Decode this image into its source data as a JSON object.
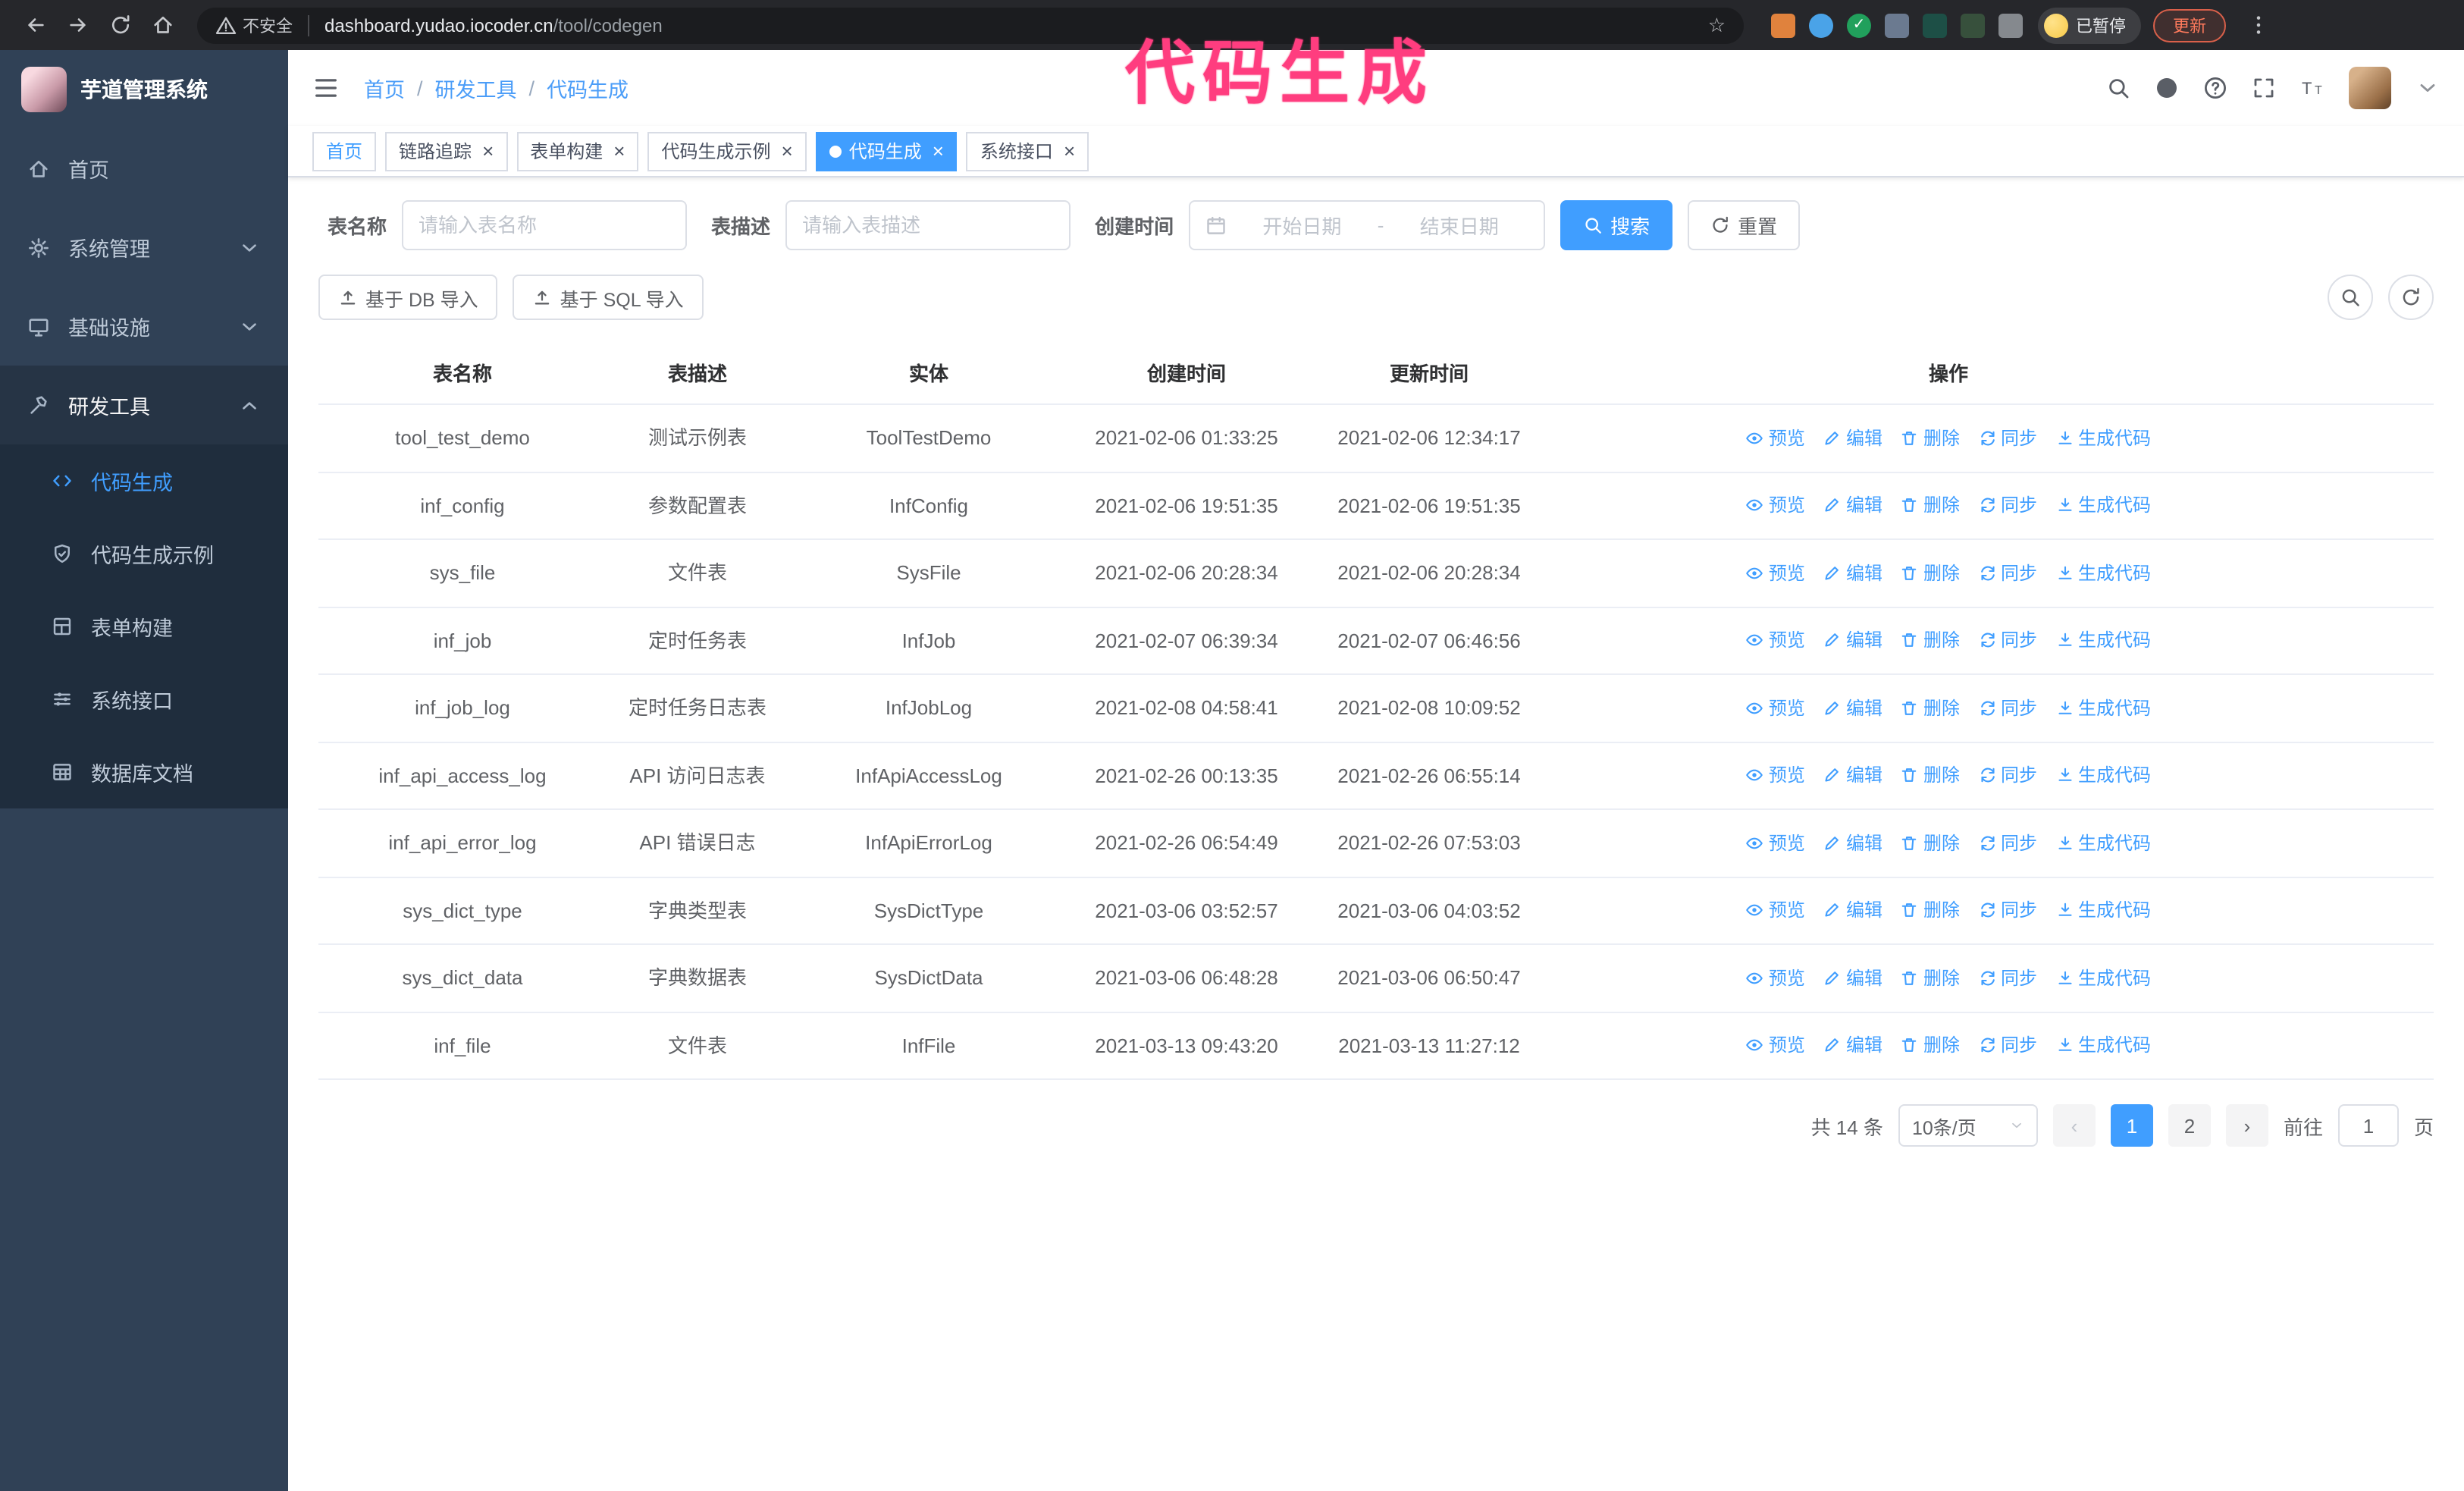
{
  "theme": {
    "primary": "#409eff",
    "sidebar_bg": "#304156",
    "submenu_bg": "#1f2d3d"
  },
  "browser": {
    "security_label": "不安全",
    "url_host": "dashboard.yudao.iocoder.cn",
    "url_path": "/tool/codegen",
    "paused_badge": "已暂停",
    "update_button": "更新",
    "extensions": [
      {
        "name": "ext-fox-icon",
        "color": "#e0823d",
        "shape": "square"
      },
      {
        "name": "ext-drop-icon",
        "color": "#4aa3e8",
        "shape": "circle"
      },
      {
        "name": "ext-check-icon",
        "color": "#21a05c",
        "shape": "circle",
        "glyph": "✓"
      },
      {
        "name": "ext-people-icon",
        "color": "#6b7a90",
        "shape": "square"
      },
      {
        "name": "ext-wallet-icon",
        "color": "#1d4f46",
        "shape": "square"
      },
      {
        "name": "ext-leaf-icon",
        "color": "#37503c",
        "shape": "square"
      },
      {
        "name": "ext-puzzle-icon",
        "color": "#85898e",
        "shape": "square"
      }
    ]
  },
  "annotation": {
    "text": "代码生成",
    "color": "#ff3d7f"
  },
  "sidebar": {
    "logo_title": "芋道管理系统",
    "menu": [
      {
        "key": "home",
        "label": "首页",
        "icon": "home-icon"
      },
      {
        "key": "system",
        "label": "系统管理",
        "icon": "gear-icon",
        "chevron": "down"
      },
      {
        "key": "infra",
        "label": "基础设施",
        "icon": "infra-icon",
        "chevron": "down"
      },
      {
        "key": "devtools",
        "label": "研发工具",
        "icon": "tools-icon",
        "chevron": "up",
        "expanded": true
      }
    ],
    "submenu": [
      {
        "key": "codegen",
        "label": "代码生成",
        "icon": "code-icon",
        "active": true
      },
      {
        "key": "codegen-demo",
        "label": "代码生成示例",
        "icon": "example-icon"
      },
      {
        "key": "form-builder",
        "label": "表单构建",
        "icon": "form-icon"
      },
      {
        "key": "system-api",
        "label": "系统接口",
        "icon": "api-icon"
      },
      {
        "key": "db-doc",
        "label": "数据库文档",
        "icon": "dbdoc-icon"
      }
    ]
  },
  "header": {
    "breadcrumb": [
      {
        "label": "首页"
      },
      {
        "label": "研发工具"
      },
      {
        "label": "代码生成"
      }
    ],
    "separator": "/"
  },
  "tags": [
    {
      "key": "home",
      "label": "首页",
      "closable": false,
      "home": true
    },
    {
      "key": "tracer",
      "label": "链路追踪",
      "closable": true
    },
    {
      "key": "form-builder",
      "label": "表单构建",
      "closable": true
    },
    {
      "key": "codegen-demo",
      "label": "代码生成示例",
      "closable": true
    },
    {
      "key": "codegen",
      "label": "代码生成",
      "closable": true,
      "active": true
    },
    {
      "key": "system-api",
      "label": "系统接口",
      "closable": true
    }
  ],
  "filters": {
    "table_name_label": "表名称",
    "table_name_placeholder": "请输入表名称",
    "table_desc_label": "表描述",
    "table_desc_placeholder": "请输入表描述",
    "create_time_label": "创建时间",
    "date_start_placeholder": "开始日期",
    "date_separator": "-",
    "date_end_placeholder": "结束日期",
    "search_button": "搜索",
    "reset_button": "重置"
  },
  "toolbar": {
    "import_db": "基于 DB 导入",
    "import_sql": "基于 SQL 导入"
  },
  "table": {
    "columns": [
      "表名称",
      "表描述",
      "实体",
      "创建时间",
      "更新时间",
      "操作"
    ],
    "row_actions": [
      "预览",
      "编辑",
      "删除",
      "同步",
      "生成代码"
    ],
    "rows": [
      [
        "tool_test_demo",
        "测试示例表",
        "ToolTestDemo",
        "2021-02-06 01:33:25",
        "2021-02-06 12:34:17"
      ],
      [
        "inf_config",
        "参数配置表",
        "InfConfig",
        "2021-02-06 19:51:35",
        "2021-02-06 19:51:35"
      ],
      [
        "sys_file",
        "文件表",
        "SysFile",
        "2021-02-06 20:28:34",
        "2021-02-06 20:28:34"
      ],
      [
        "inf_job",
        "定时任务表",
        "InfJob",
        "2021-02-07 06:39:34",
        "2021-02-07 06:46:56"
      ],
      [
        "inf_job_log",
        "定时任务日志表",
        "InfJobLog",
        "2021-02-08 04:58:41",
        "2021-02-08 10:09:52"
      ],
      [
        "inf_api_access_log",
        "API 访问日志表",
        "InfApiAccessLog",
        "2021-02-26 00:13:35",
        "2021-02-26 06:55:14"
      ],
      [
        "inf_api_error_log",
        "API 错误日志",
        "InfApiErrorLog",
        "2021-02-26 06:54:49",
        "2021-02-26 07:53:03"
      ],
      [
        "sys_dict_type",
        "字典类型表",
        "SysDictType",
        "2021-03-06 03:52:57",
        "2021-03-06 04:03:52"
      ],
      [
        "sys_dict_data",
        "字典数据表",
        "SysDictData",
        "2021-03-06 06:48:28",
        "2021-03-06 06:50:47"
      ],
      [
        "inf_file",
        "文件表",
        "InfFile",
        "2021-03-13 09:43:20",
        "2021-03-13 11:27:12"
      ]
    ]
  },
  "pagination": {
    "total": "共 14 条",
    "page_size": "10条/页",
    "prev": "‹",
    "next": "›",
    "pages": [
      {
        "label": "1",
        "active": true
      },
      {
        "label": "2"
      }
    ],
    "goto_prefix": "前往",
    "goto_value": "1",
    "goto_suffix": "页"
  }
}
